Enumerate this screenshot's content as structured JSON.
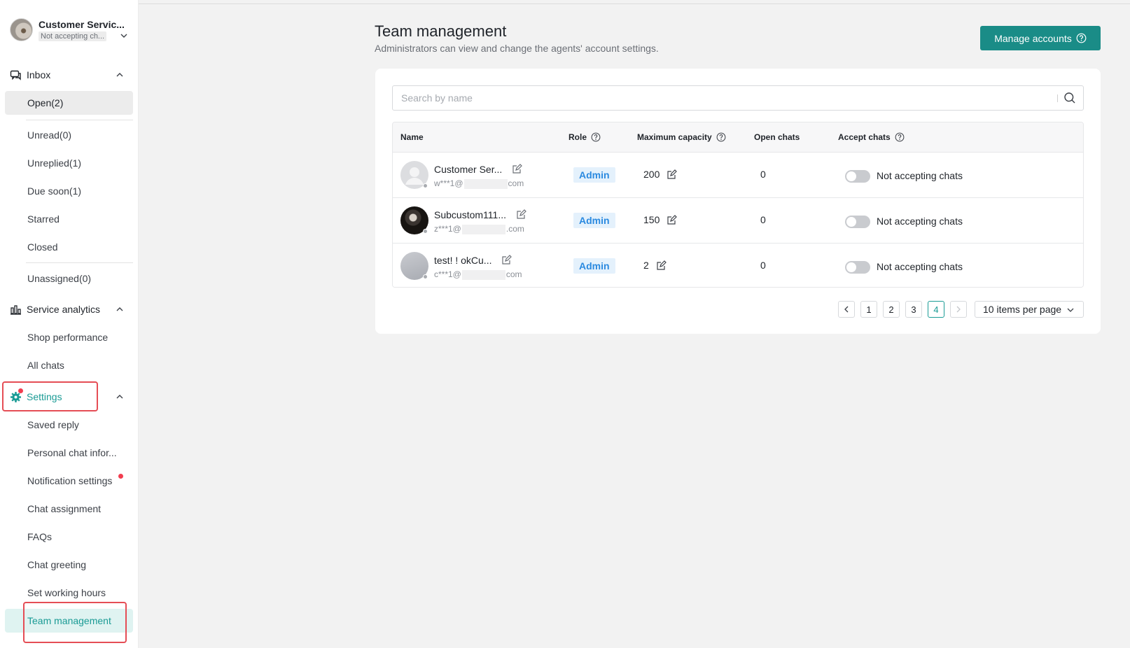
{
  "colors": {
    "accent": "#1a9b95",
    "button": "#1a8c87",
    "highlight": "#e54d55",
    "badge_bg": "#e4f1fc",
    "badge_text": "#2b8ae0"
  },
  "profile": {
    "name": "Customer Servic...",
    "status": "Not accepting ch..."
  },
  "sidebar": {
    "inbox": {
      "label": "Inbox",
      "icon": "chat-bubbles-icon",
      "items": [
        "Open(2)",
        "Unread(0)",
        "Unreplied(1)",
        "Due soon(1)",
        "Starred",
        "Closed",
        "Unassigned(0)"
      ]
    },
    "analytics": {
      "label": "Service analytics",
      "icon": "bar-chart-icon",
      "items": [
        "Shop performance",
        "All chats"
      ]
    },
    "settings": {
      "label": "Settings",
      "icon": "gear-icon",
      "items": [
        "Saved reply",
        "Personal chat infor...",
        "Notification settings",
        "Chat assignment",
        "FAQs",
        "Chat greeting",
        "Set working hours",
        "Team management"
      ]
    }
  },
  "main": {
    "title": "Team management",
    "subtitle": "Administrators can view and change the agents' account settings.",
    "manage_button": "Manage accounts",
    "search_placeholder": "Search by name",
    "columns": [
      "Name",
      "Role",
      "Maximum capacity",
      "Open chats",
      "Accept chats"
    ],
    "rows": [
      {
        "name": "Customer Ser...",
        "email_start": "w***1@",
        "email_end": "com",
        "role": "Admin",
        "capacity": "200",
        "open_chats": "0",
        "accept": "Not accepting chats"
      },
      {
        "name": "Subcustom111...",
        "email_start": "z***1@",
        "email_end": ".com",
        "role": "Admin",
        "capacity": "150",
        "open_chats": "0",
        "accept": "Not accepting chats"
      },
      {
        "name": "test!  !  okCu...",
        "email_start": "c***1@",
        "email_end": "com",
        "role": "Admin",
        "capacity": "2",
        "open_chats": "0",
        "accept": "Not accepting chats"
      }
    ],
    "pagination": {
      "pages": [
        "1",
        "2",
        "3",
        "4"
      ],
      "current": "4",
      "per_page": "10 items per page"
    }
  }
}
